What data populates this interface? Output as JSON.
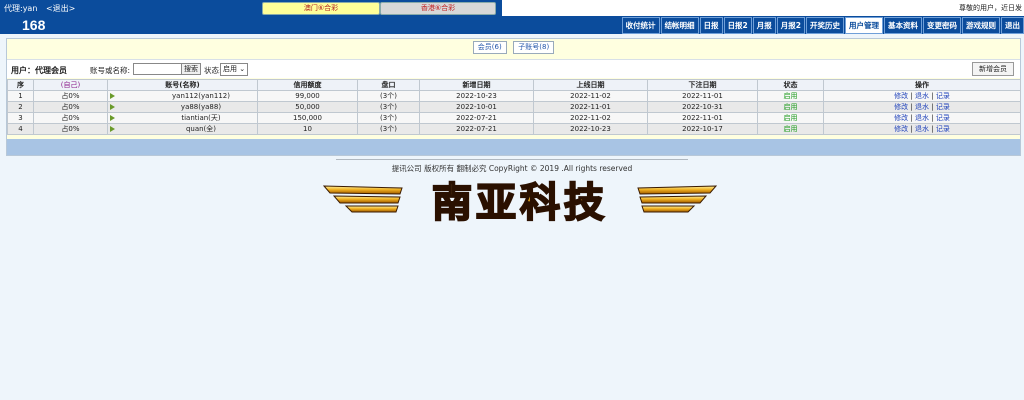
{
  "topbar": {
    "agent_label": "代理:yan",
    "logout_label": "<退出>",
    "macau_btn": "澳门⑥合彩",
    "hk_btn": "香港⑥合彩",
    "marquee": "尊敬的用户，近日发"
  },
  "navbar": {
    "logo": "168",
    "items": [
      {
        "label": "收付统计"
      },
      {
        "label": "结帐明细"
      },
      {
        "label": "日报"
      },
      {
        "label": "日报2"
      },
      {
        "label": "月报"
      },
      {
        "label": "月报2"
      },
      {
        "label": "开奖历史"
      },
      {
        "label": "用户管理",
        "active": true
      },
      {
        "label": "基本资料"
      },
      {
        "label": "变更密码"
      },
      {
        "label": "游戏规则"
      },
      {
        "label": "退出"
      }
    ]
  },
  "tabs": {
    "members": "会员(6)",
    "subaccounts": "子账号(8)"
  },
  "filter": {
    "user_label": "用户：代理会员",
    "account_label": "账号或名称:",
    "account_value": "",
    "search_button": "搜索",
    "status_label": "状态:",
    "status_value": "启用",
    "add_member_button": "新增会员"
  },
  "table": {
    "headers": [
      "序",
      "(自己)",
      "账号(名称)",
      "信用额度",
      "盘口",
      "新增日期",
      "上线日期",
      "下注日期",
      "状态",
      "操作"
    ],
    "rows": [
      {
        "idx": "1",
        "share": "占0%",
        "account": "yan112(yan112)",
        "credit": "99,000",
        "plate": "(3个)",
        "created": "2022-10-23",
        "online": "2022-11-02",
        "bet": "2022-11-01",
        "status": "启用"
      },
      {
        "idx": "2",
        "share": "占0%",
        "account": "ya88(ya88)",
        "credit": "50,000",
        "plate": "(3个)",
        "created": "2022-10-01",
        "online": "2022-11-01",
        "bet": "2022-10-31",
        "status": "启用"
      },
      {
        "idx": "3",
        "share": "占0%",
        "account": "tiantian(天)",
        "credit": "150,000",
        "plate": "(3个)",
        "created": "2022-07-21",
        "online": "2022-11-02",
        "bet": "2022-11-01",
        "status": "启用"
      },
      {
        "idx": "4",
        "share": "占0%",
        "account": "quan(全)",
        "credit": "10",
        "plate": "(3个)",
        "created": "2022-07-21",
        "online": "2022-10-23",
        "bet": "2022-10-17",
        "status": "启用"
      }
    ],
    "ops": {
      "edit": "修改",
      "rebate": "退水",
      "record": "记录",
      "sep": "|"
    }
  },
  "footer": {
    "copyright": "提讯公司 版权所有 翻制必究 CopyRight © 2019 .All rights reserved",
    "logo_text": "南亚科技"
  }
}
